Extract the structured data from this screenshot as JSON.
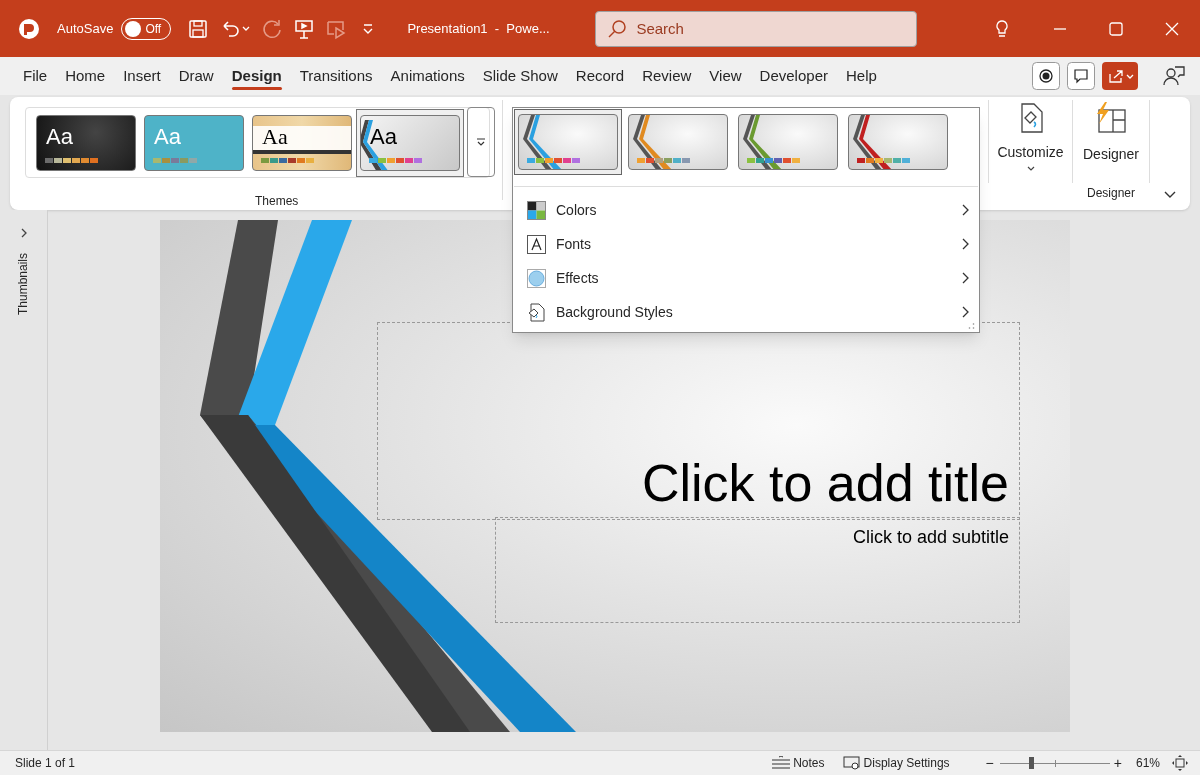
{
  "title_bar": {
    "autosave_label": "AutoSave",
    "autosave": {
      "on": false,
      "label": "Off"
    },
    "document_title": "Presentation1  -  Powe...",
    "search": {
      "placeholder": "Search"
    }
  },
  "tabs": [
    {
      "label": "File",
      "selected": false
    },
    {
      "label": "Home",
      "selected": false
    },
    {
      "label": "Insert",
      "selected": false
    },
    {
      "label": "Draw",
      "selected": false
    },
    {
      "label": "Design",
      "selected": true
    },
    {
      "label": "Transitions",
      "selected": false
    },
    {
      "label": "Animations",
      "selected": false
    },
    {
      "label": "Slide Show",
      "selected": false
    },
    {
      "label": "Record",
      "selected": false
    },
    {
      "label": "Review",
      "selected": false
    },
    {
      "label": "View",
      "selected": false
    },
    {
      "label": "Developer",
      "selected": false
    },
    {
      "label": "Help",
      "selected": false
    }
  ],
  "themes": {
    "label": "Themes",
    "items": [
      {
        "label": "Aa",
        "selected": false,
        "kind": "dark"
      },
      {
        "label": "Aa",
        "selected": false,
        "kind": "teal"
      },
      {
        "label": "Aa",
        "selected": false,
        "kind": "wood"
      },
      {
        "label": "Aa",
        "selected": true,
        "kind": "facet"
      }
    ]
  },
  "variants": {
    "items": [
      {
        "selected": true,
        "kind": "blue"
      },
      {
        "selected": false,
        "kind": "orange"
      },
      {
        "selected": false,
        "kind": "green"
      },
      {
        "selected": false,
        "kind": "red"
      }
    ]
  },
  "variants_menu": [
    {
      "kind": "colors",
      "label": "Colors"
    },
    {
      "kind": "fonts",
      "label": "Fonts"
    },
    {
      "kind": "effects",
      "label": "Effects"
    },
    {
      "kind": "background",
      "label": "Background Styles"
    }
  ],
  "customize": {
    "label": "Customize"
  },
  "designer": {
    "button": "Designer",
    "group_label": "Designer"
  },
  "thumbnails_label": "Thumbnails",
  "slide": {
    "title": "Click to add title",
    "subtitle": "Click to add subtitle"
  },
  "status_bar": {
    "slide_info": "Slide 1 of 1",
    "notes": "Notes",
    "display_settings": "Display Settings",
    "zoom_out": "−",
    "zoom_in": "+",
    "zoom": {
      "level": 0.28
    },
    "zoom_percent": "61%"
  }
}
